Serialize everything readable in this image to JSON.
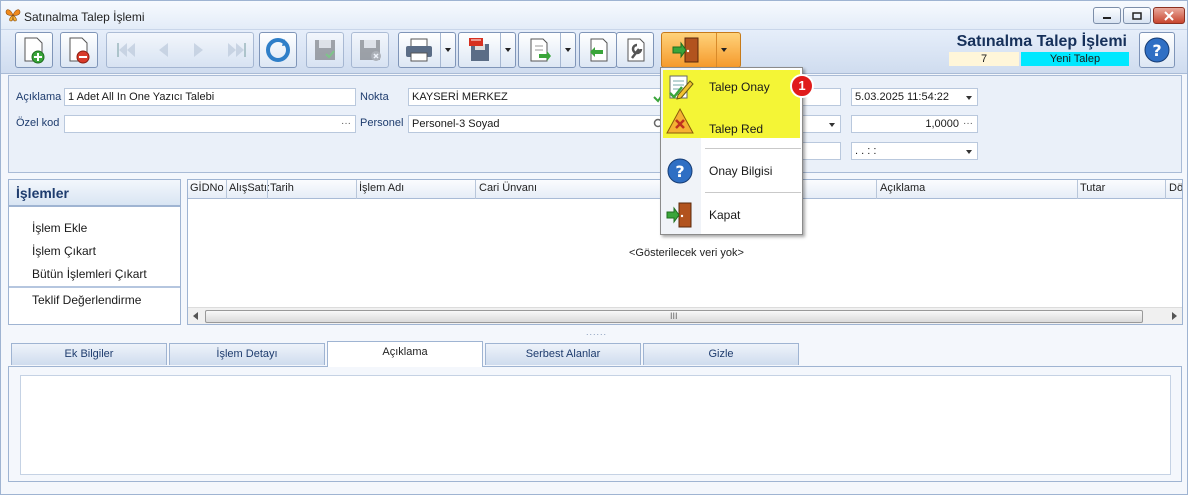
{
  "window": {
    "title": "Satınalma Talep İşlemi"
  },
  "header": {
    "heading": "Satınalma Talep İşlemi",
    "record_id": "7",
    "status": "Yeni Talep",
    "status_color": "#00e8ff"
  },
  "form": {
    "aciklama_label": "Açıklama",
    "aciklama_value": "1 Adet All In One Yazıcı Talebi",
    "ozel_kod_label": "Özel kod",
    "ozel_kod_value": "",
    "nokta_label": "Nokta",
    "nokta_value": "KAYSERİ MERKEZ",
    "personel_label": "Personel",
    "personel_value": "Personel-3 Soyad",
    "date_value": "5.03.2025 11:54:22",
    "amount_value": "1,0000",
    "empty_date_value": ".  .     :  :"
  },
  "actions": {
    "title": "İşlemler",
    "items": [
      "İşlem Ekle",
      "İşlem Çıkart",
      "Bütün İşlemleri Çıkart",
      "Teklif Değerlendirme"
    ]
  },
  "grid": {
    "columns": [
      "GİDNo",
      "AlışSatı:",
      "Tarih",
      "İşlem Adı",
      "Cari Ünvanı",
      "Açıklama",
      "Tutar",
      "Dö"
    ],
    "empty_text": "<Gösterilecek veri yok>",
    "scroll_grip": "III"
  },
  "splitter_grip": "......",
  "tabs": [
    "Ek Bilgiler",
    "İşlem Detayı",
    "Açıklama",
    "Serbest Alanlar",
    "Gizle"
  ],
  "selected_tab": "Açıklama",
  "menu": {
    "items": [
      {
        "label": "Talep Onay",
        "icon": "approve-pencil-icon"
      },
      {
        "label": "Talep Red",
        "icon": "reject-x-icon"
      },
      {
        "label": "Onay Bilgisi",
        "icon": "question-icon"
      },
      {
        "label": "Kapat",
        "icon": "exit-door-icon"
      }
    ],
    "highlight_color": "#f4f536"
  },
  "badge": "1"
}
